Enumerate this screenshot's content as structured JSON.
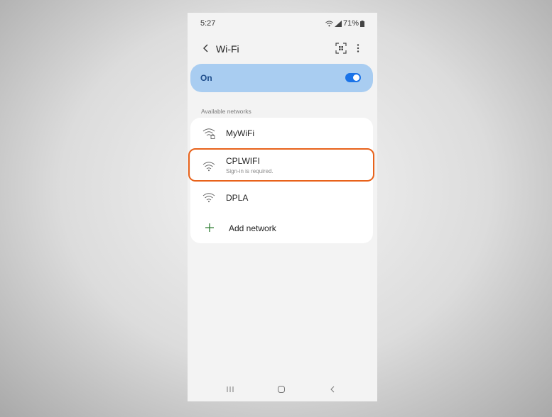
{
  "status_bar": {
    "time": "5:27",
    "battery": "71%"
  },
  "app_bar": {
    "title": "Wi-Fi"
  },
  "wifi_toggle": {
    "label": "On",
    "state": "on"
  },
  "available_networks": {
    "header": "Available networks",
    "items": [
      {
        "name": "MyWiFi",
        "subtitle": "",
        "icon": "wifi-lock-icon"
      },
      {
        "name": "CPLWIFI",
        "subtitle": "Sign-in is required.",
        "icon": "wifi-icon"
      },
      {
        "name": "DPLA",
        "subtitle": "",
        "icon": "wifi-icon"
      }
    ],
    "add_label": "Add network"
  },
  "colors": {
    "accent": "#1a73e8",
    "highlight": "#e8621a",
    "toggle_card": "#a9cdf1"
  }
}
